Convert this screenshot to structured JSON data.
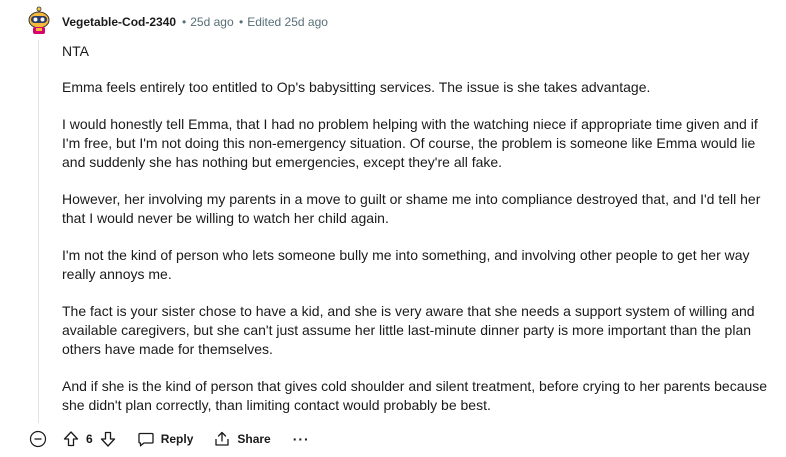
{
  "comment": {
    "username": "Vegetable-Cod-2340",
    "separator": "•",
    "age": "25d ago",
    "edited_separator": "•",
    "edited": "Edited 25d ago",
    "paragraphs": [
      "NTA",
      "Emma feels entirely too entitled to Op's babysitting services. The issue is she takes advantage.",
      "I would honestly tell Emma, that I had no problem helping with the watching niece if appropriate time given and if I'm free, but I'm not doing this non-emergency situation. Of course, the problem is someone like Emma would lie and suddenly she has nothing but emergencies, except they're all fake.",
      "However, her involving my parents in a move to guilt or shame me into compliance destroyed that, and I'd tell her that I would never be willing to watch her child again.",
      "I'm not the kind of person who lets someone bully me into something, and involving other people to get her way really annoys me.",
      "The fact is your sister chose to have a kid, and she is very aware that she needs a support system of willing and available caregivers, but she can't just assume her little last-minute dinner party is more important than the plan others have made for themselves.",
      "And if she is the kind of person that gives cold shoulder and silent treatment, before crying to her parents because she didn't plan correctly, than limiting contact would probably be best."
    ]
  },
  "actions": {
    "collapse_icon": "collapse-minus-icon",
    "upvote_icon": "upvote-arrow-icon",
    "score": "6",
    "downvote_icon": "downvote-arrow-icon",
    "reply_icon": "speech-bubble-icon",
    "reply_label": "Reply",
    "share_icon": "share-arrow-icon",
    "share_label": "Share",
    "more_label": "···"
  },
  "colors": {
    "text": "#1a1a1b",
    "meta": "#576f76",
    "thread_line": "#e2e4e6",
    "avatar_bg": "#f6b93b",
    "avatar_accent": "#d6006e"
  }
}
